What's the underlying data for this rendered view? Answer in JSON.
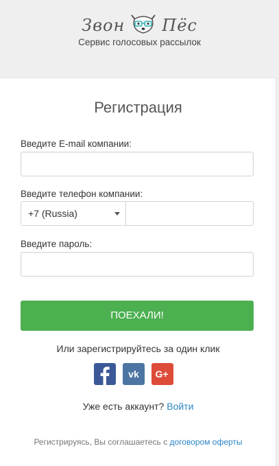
{
  "header": {
    "logo_left": "Звон",
    "logo_right": "Пёс",
    "tagline": "Сервис голосовых рассылок"
  },
  "form": {
    "title": "Регистрация",
    "email_label": "Введите E-mail компании:",
    "email_value": "",
    "phone_label": "Введите телефон компании:",
    "country_selected": "+7 (Russia)",
    "phone_value": "",
    "password_label": "Введите пароль:",
    "password_value": "",
    "submit_label": "ПОЕХАЛИ!"
  },
  "social": {
    "prompt": "Или зарегистрируйтесь за один клик",
    "icons": [
      "facebook-icon",
      "vk-icon",
      "google-plus-icon"
    ]
  },
  "login": {
    "prompt": "Уже есть аккаунт?",
    "link_label": "Войти"
  },
  "terms": {
    "text": "Регистрируясь, Вы соглашаетесь с",
    "link_label": "договором оферты"
  },
  "colors": {
    "submit_bg": "#4caf50",
    "link": "#2a85c4",
    "facebook": "#3b5998",
    "vk": "#4c75a3",
    "google": "#dd4b39"
  }
}
